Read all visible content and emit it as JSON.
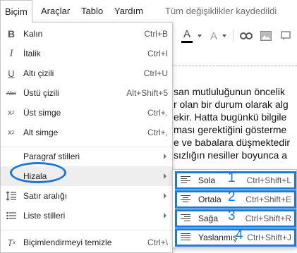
{
  "menubar": {
    "items": [
      "Biçim",
      "Araçlar",
      "Tablo",
      "Yardım"
    ],
    "saved_status": "Tüm değişiklikler kaydedildi"
  },
  "toolbar": {
    "text_color_label": "A",
    "highlight_label": "A",
    "icons": [
      "text-color-icon",
      "highlight-icon",
      "link-icon",
      "image-icon",
      "comment-icon"
    ]
  },
  "document": {
    "lines": [
      "san mutluluğunun öncelik",
      "r olan bir durum olarak alg",
      "ekir. Hatta bugünkü bilgile",
      "ması gerektiğini gösterme",
      "e ve babalara düşmektedir",
      "sızlığın nesiller boyunca a"
    ]
  },
  "menu": {
    "items": [
      {
        "label": "Kalın",
        "shortcut": "Ctrl+B",
        "icon": "bold-icon"
      },
      {
        "label": "İtalik",
        "shortcut": "Ctrl+I",
        "icon": "italic-icon"
      },
      {
        "label": "Altı çizili",
        "shortcut": "Ctrl+U",
        "icon": "underline-icon"
      },
      {
        "label": "Üstü çizili",
        "shortcut": "Alt+Shift+5",
        "icon": "strikethrough-icon"
      },
      {
        "label": "Üst simge",
        "shortcut": "Ctrl+.",
        "icon": "superscript-icon"
      },
      {
        "label": "Alt simge",
        "shortcut": "Ctrl+,",
        "icon": "subscript-icon"
      },
      {
        "label": "Paragraf stilleri",
        "icon": ""
      },
      {
        "label": "Hizala",
        "icon": ""
      },
      {
        "label": "Satır aralığı",
        "icon": "line-spacing-icon"
      },
      {
        "label": "Liste stilleri",
        "icon": "list-styles-icon"
      },
      {
        "label": "Biçimlendirmeyi temizle",
        "shortcut": "Ctrl+\\",
        "icon": "clear-formatting-icon"
      }
    ]
  },
  "submenu": {
    "items": [
      {
        "label": "Sola",
        "number": "1",
        "shortcut": "Ctrl+Shift+L"
      },
      {
        "label": "Ortala",
        "number": "2",
        "shortcut": "Ctrl+Shift+E"
      },
      {
        "label": "Sağa",
        "number": "3",
        "shortcut": "Ctrl+Shift+R"
      },
      {
        "label": "Yaslanmış",
        "number": "4",
        "shortcut": "Ctrl+Shift+J"
      }
    ]
  },
  "colors": {
    "annotation_blue": "#1a7ad9",
    "highlight_row": "#eeeeee"
  }
}
